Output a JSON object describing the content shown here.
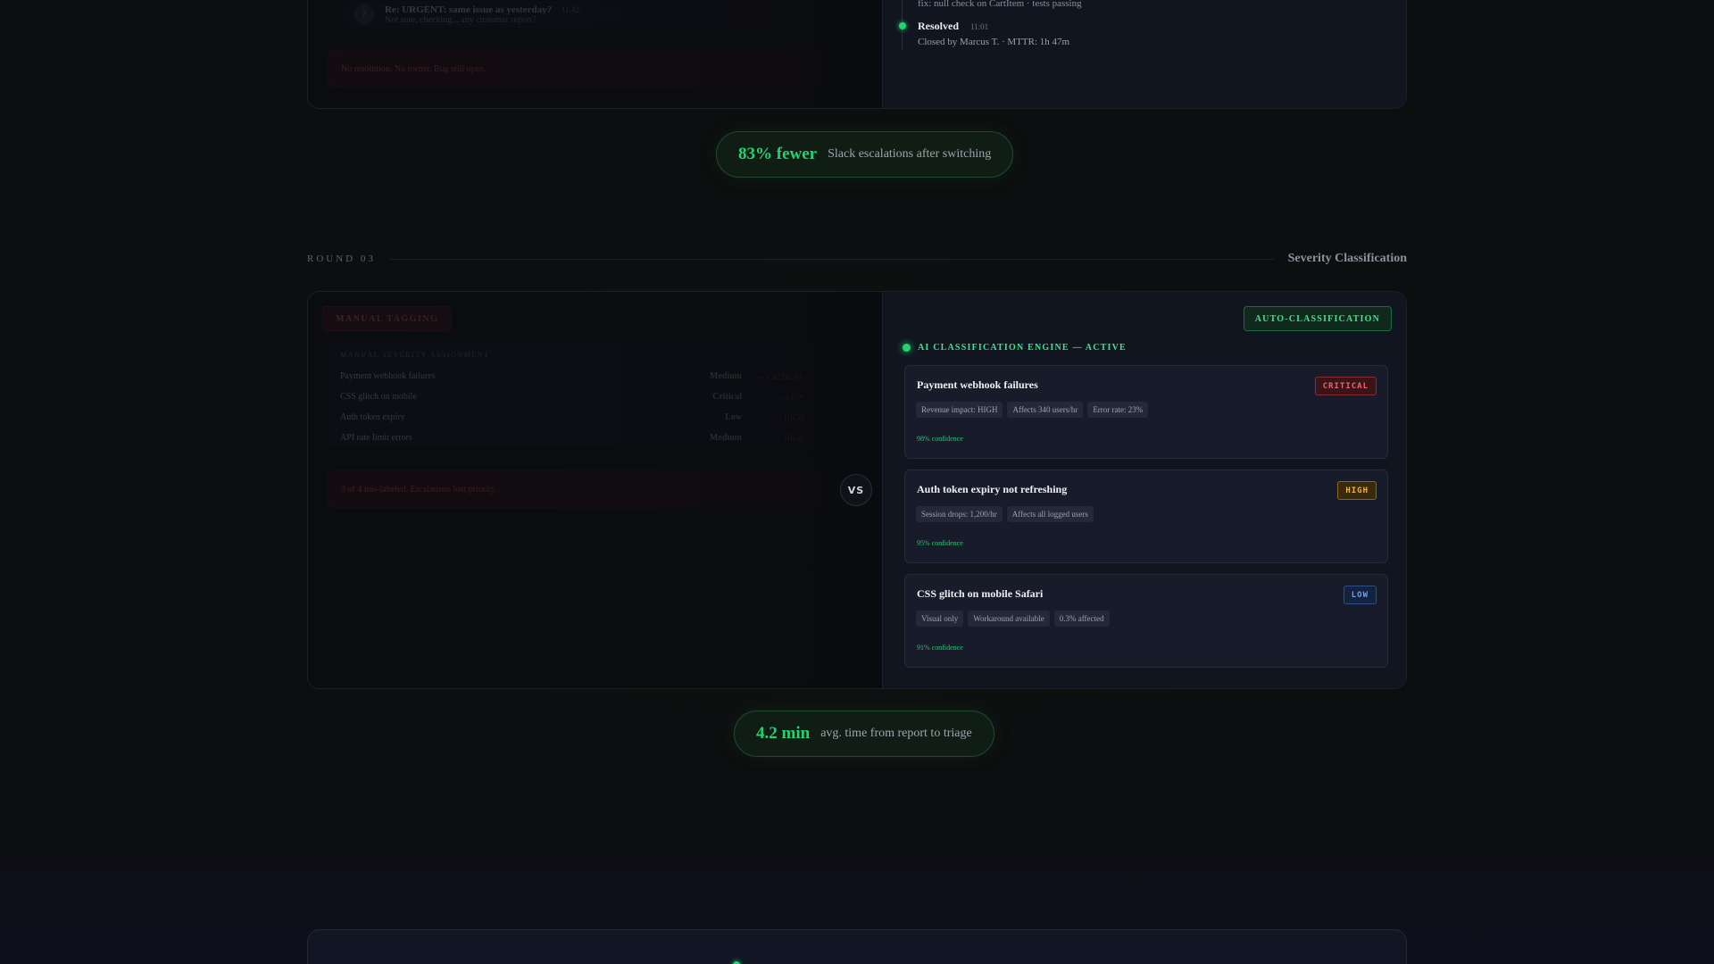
{
  "round02": {
    "slack_message": {
      "avatar": "?",
      "title": "Re: URGENT: same issue as yesterday?",
      "time": "11:42",
      "preview": "Not sure, checking... any customer report?"
    },
    "warning": "No resolution. No owner. Bug still open.",
    "timeline": {
      "commit": "fix: null check on CartItem · tests passing",
      "resolved_label": "Resolved",
      "resolved_time": "11:01",
      "closed_by": "Closed by Marcus T. · MTTR: 1h 47m"
    }
  },
  "stat_escalations": {
    "value": "83% fewer",
    "label": "Slack escalations after switching"
  },
  "round03": {
    "label": "ROUND 03",
    "title": "Severity Classification",
    "manual": {
      "badge": "MANUAL TAGGING",
      "sheet_heading": "MANUAL SEVERITY ASSIGNMENT",
      "rows": [
        {
          "name": "Payment webhook failures",
          "severity": "Medium",
          "correction": "→ CRITICAL"
        },
        {
          "name": "CSS glitch on mobile",
          "severity": "Critical",
          "correction": "→ LOW"
        },
        {
          "name": "Auth token expiry",
          "severity": "Low",
          "correction": "→ HIGH"
        },
        {
          "name": "API rate limit errors",
          "severity": "Medium",
          "correction": "→ HIGH"
        }
      ],
      "warning": "3 of 4 mis-labeled. Escalations lost priority."
    },
    "vs": "VS",
    "auto": {
      "badge": "AUTO-CLASSIFICATION",
      "engine_status": "AI CLASSIFICATION ENGINE — ACTIVE",
      "issues": [
        {
          "title": "Payment webhook failures",
          "severity": "CRITICAL",
          "chips": [
            "Revenue impact: HIGH",
            "Affects 340 users/hr",
            "Error rate: 23%"
          ],
          "confidence": "98% confidence"
        },
        {
          "title": "Auth token expiry not refreshing",
          "severity": "HIGH",
          "chips": [
            "Session drops: 1,200/hr",
            "Affects all logged users"
          ],
          "confidence": "95% confidence"
        },
        {
          "title": "CSS glitch on mobile Safari",
          "severity": "LOW",
          "chips": [
            "Visual only",
            "Workaround available",
            "0.3% affected"
          ],
          "confidence": "91% confidence"
        }
      ]
    }
  },
  "stat_triage": {
    "value": "4.2 min",
    "label": "avg. time from report to triage"
  },
  "colors": {
    "accent_green": "#22d36f",
    "critical": "#f0626a",
    "high": "#f2b33a",
    "low": "#6fa2ee"
  }
}
